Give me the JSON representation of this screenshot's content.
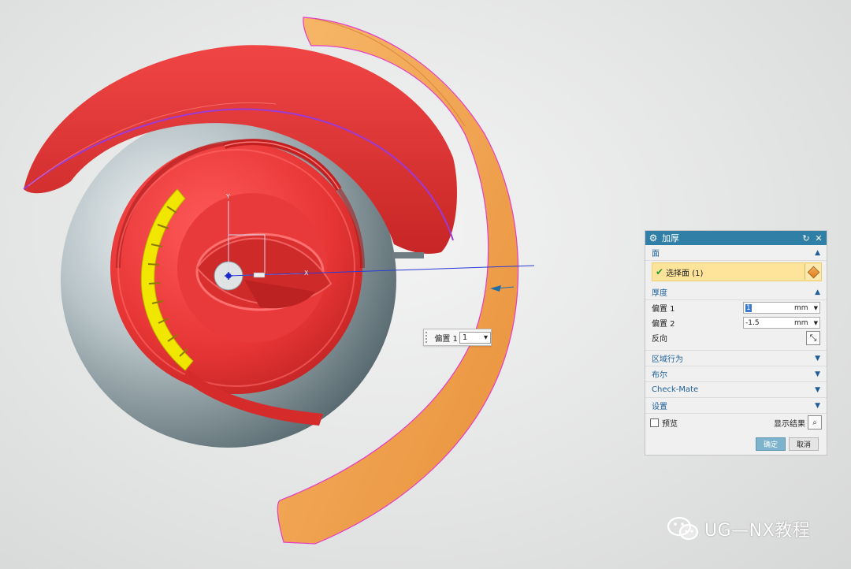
{
  "viewport": {
    "axis_labels": {
      "y": "Y",
      "x": "X"
    },
    "colors": {
      "red_body": "#e83a3a",
      "orange_shell": "#f5a95a",
      "sphere": "#9aa8ad",
      "yellow_face": "#f0e600"
    }
  },
  "float_input": {
    "label": "偏置 1",
    "value": "1"
  },
  "dialog": {
    "title": "加厚",
    "title_icons": [
      "gear-icon",
      "reset-icon",
      "close-icon"
    ],
    "face_section": {
      "header": "面",
      "select_label": "选择面 (1)"
    },
    "thickness_section": {
      "header": "厚度",
      "offset1": {
        "label": "偏置 1",
        "value": "1",
        "unit": "mm"
      },
      "offset2": {
        "label": "偏置 2",
        "value": "-1.5",
        "unit": "mm"
      },
      "reverse_label": "反向"
    },
    "collapsed_sections": [
      "区域行为",
      "布尔",
      "Check-Mate",
      "设置"
    ],
    "preview_label": "预览",
    "show_result_label": "显示结果",
    "ok_label": "确定",
    "cancel_label": "取消"
  },
  "watermark": {
    "text": "UG—NX教程"
  }
}
